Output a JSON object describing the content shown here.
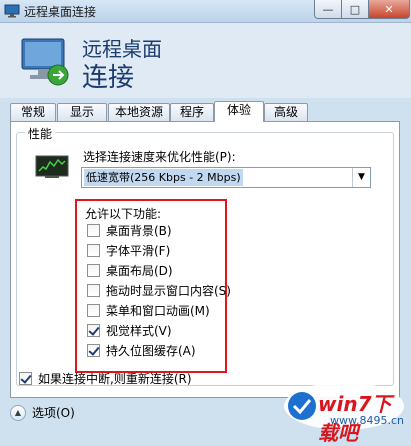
{
  "window": {
    "title": "远程桌面连接",
    "min_symbol": "—",
    "max_symbol": "□",
    "close_symbol": "✕"
  },
  "header": {
    "line1": "远程桌面",
    "line2": "连接"
  },
  "tabs": [
    {
      "label": "常规"
    },
    {
      "label": "显示"
    },
    {
      "label": "本地资源"
    },
    {
      "label": "程序"
    },
    {
      "label": "体验",
      "active": true
    },
    {
      "label": "高级"
    }
  ],
  "performance": {
    "group_title": "性能",
    "speed_label": "选择连接速度来优化性能(P):",
    "speed_value": "低速宽带(256 Kbps - 2 Mbps)",
    "features_title": "允许以下功能:",
    "features": [
      {
        "label": "桌面背景(B)",
        "checked": false
      },
      {
        "label": "字体平滑(F)",
        "checked": false
      },
      {
        "label": "桌面布局(D)",
        "checked": false
      },
      {
        "label": "拖动时显示窗口内容(S)",
        "checked": false
      },
      {
        "label": "菜单和窗口动画(M)",
        "checked": false
      },
      {
        "label": "视觉样式(V)",
        "checked": true
      },
      {
        "label": "持久位图缓存(A)",
        "checked": true
      }
    ]
  },
  "reconnect": {
    "label": "如果连接中断,则重新连接(R)",
    "checked": true
  },
  "options": {
    "label": "选项(O)",
    "icon": "chevron-up-icon"
  },
  "watermark": {
    "brand": "win7下载吧",
    "url": "www.8495.cn"
  },
  "colors": {
    "highlight_box": "#e0161a",
    "title_blue": "#1c3c6e",
    "selection": "#c0d8f0"
  }
}
